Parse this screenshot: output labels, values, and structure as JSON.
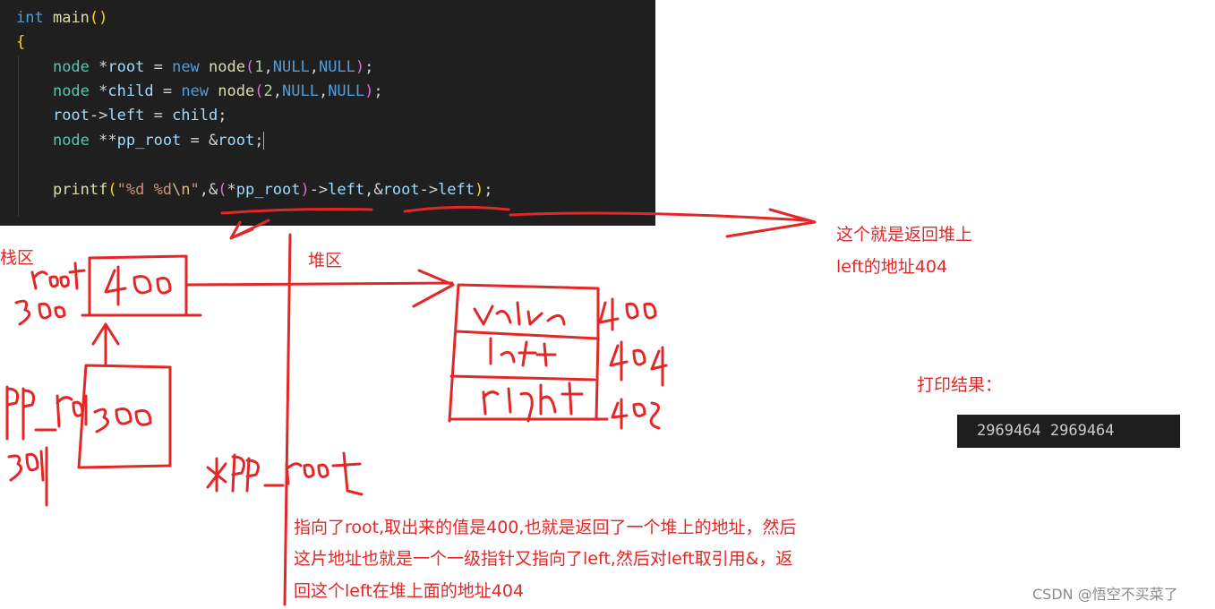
{
  "code": {
    "line1": [
      "int",
      "main",
      "()"
    ],
    "line2": [
      "{"
    ],
    "line3": [
      "node",
      "*",
      "root",
      " = ",
      "new",
      "node",
      "(",
      "1",
      ",",
      "NULL",
      ",",
      "NULL",
      ")",
      ";"
    ],
    "line4": [
      "node",
      "*",
      "child",
      " = ",
      "new",
      "node",
      "(",
      "2",
      ",",
      "NULL",
      ",",
      "NULL",
      ")",
      ";"
    ],
    "line5": [
      "root",
      "->",
      "left",
      " = ",
      "child",
      ";"
    ],
    "line6": [
      "node",
      "**",
      "pp_root",
      " = ",
      "&",
      "root",
      ";"
    ],
    "line7": [
      "printf",
      "(",
      "\"%d %d",
      "\\n",
      "\"",
      ",",
      "&",
      "(",
      "*",
      "pp_root",
      ")",
      "->",
      "left",
      ",",
      "&",
      "root",
      "->",
      "left",
      ")",
      ";"
    ]
  },
  "annotations": {
    "stack_label": "栈区",
    "heap_label": "堆区",
    "right_note_line1": "这个就是返回堆上",
    "right_note_line2": "left的地址404",
    "print_label": "打印结果：",
    "bottom_note_line1": "指向了root,取出来的值是400,也就是返回了一个堆上的地址，然后",
    "bottom_note_line2": "这片地址也就是一个一级指针又指向了left,然后对left取引用&，返",
    "bottom_note_line3": "回这个left在堆上面的地址404"
  },
  "result": {
    "output": "2969464 2969464"
  },
  "watermark": "CSDN @悟空不买菜了",
  "colors": {
    "editor_bg": "#1f1f1f",
    "annotation_red": "#e32727",
    "terminal_bg": "#1e1e1e"
  }
}
